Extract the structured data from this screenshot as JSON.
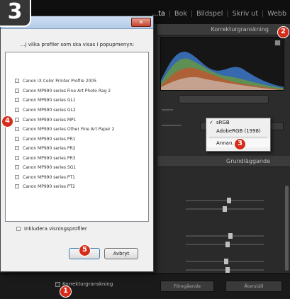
{
  "step_title": "3",
  "steps": {
    "s1": "1",
    "s2": "2",
    "s3": "3",
    "s4": "4",
    "s5": "5"
  },
  "module_nav": {
    "items": [
      {
        "label": "...ta",
        "active": true
      },
      {
        "label": "Bok",
        "active": false
      },
      {
        "label": "Bildspel",
        "active": false
      },
      {
        "label": "Skriv ut",
        "active": false
      },
      {
        "label": "Webb",
        "active": false
      }
    ],
    "separators": [
      "|",
      "|",
      "|",
      "|"
    ]
  },
  "lightroom_panel": {
    "header": "Korrekturgranskning",
    "tone_header": "Grundläggande"
  },
  "popup_menu": {
    "items": [
      {
        "label": "sRGB",
        "checked": true
      },
      {
        "label": "AdobeRGB (1998)",
        "checked": false
      }
    ],
    "other_label": "Annan..."
  },
  "dialog": {
    "instruction": "...j vilka profiler som ska visas i popupmenyn:",
    "profiles": [
      "Canon iX Color Printer Profile 2005",
      "Canon MP990 series Fine Art Photo Rag 2",
      "Canon MP990 series GL1",
      "Canon MP990 series GL2",
      "Canon MP990 series MP1",
      "Canon MP990 series Other Fine Art Paper 2",
      "Canon MP990 series PR1",
      "Canon MP990 series PR2",
      "Canon MP990 series PR3",
      "Canon MP990 series SG1",
      "Canon MP990 series PT1",
      "Canon MP990 series PT2"
    ],
    "include_label": "Inkludera visningsprofiler",
    "ok_label": "OK",
    "cancel_label": "Avbryt"
  },
  "bottom_bar": {
    "proof_toggle_label": "Korrekturgranskning",
    "btn_left": "Föregående",
    "btn_right": "Återställ"
  },
  "colors": {
    "accent_red": "#d62c1a"
  }
}
